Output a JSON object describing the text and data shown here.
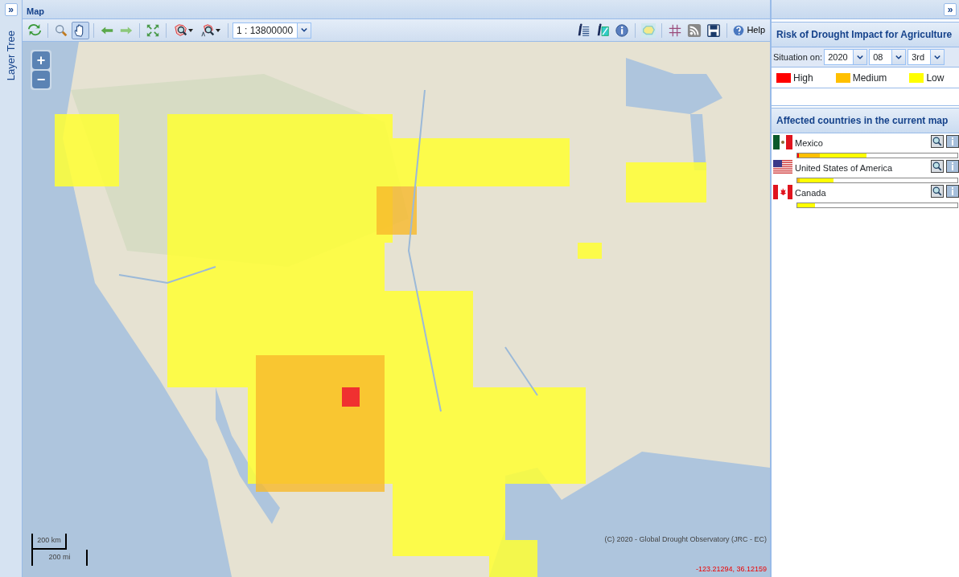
{
  "left_panel": {
    "expand_button": "»",
    "title": "Layer Tree"
  },
  "map_panel": {
    "title": "Map",
    "toolbar_left": [
      {
        "kind": "refresh",
        "selected": false
      },
      {
        "kind": "zoom",
        "selected": false
      },
      {
        "kind": "pan",
        "selected": true
      },
      {
        "kind": "back",
        "selected": false
      },
      {
        "kind": "forward",
        "selected": false
      },
      {
        "kind": "extent",
        "selected": false
      },
      {
        "kind": "region-zoom",
        "selected": false
      },
      {
        "kind": "label-zoom",
        "selected": false
      }
    ],
    "scale_select": {
      "value": "1 : 13800000"
    },
    "toolbar_right": [
      {
        "kind": "info-list"
      },
      {
        "kind": "info-edit"
      },
      {
        "kind": "info"
      },
      {
        "kind": "polygon"
      },
      {
        "kind": "grid"
      },
      {
        "kind": "rss"
      },
      {
        "kind": "save"
      }
    ],
    "help_button": "Help",
    "zoom_controls": [
      "+",
      "−"
    ],
    "scale_bar": {
      "metric": "200 km",
      "imperial": "200 mi"
    },
    "attribution": "(C) 2020 - Global Drought Observatory (JRC - EC)",
    "coordinates": "-123.21294, 36.12159"
  },
  "right_panel": {
    "expand_button": "»",
    "title": "Risk of Drought Impact for Agriculture",
    "situation": {
      "label": "Situation on:",
      "selects": [
        "2020",
        "08",
        "3rd"
      ]
    },
    "legend": [
      {
        "label": "High",
        "color": "#ff0000"
      },
      {
        "label": "Medium",
        "color": "#ffc000"
      },
      {
        "label": "Low",
        "color": "#ffff00"
      }
    ],
    "affected_title": "Affected countries in the current map",
    "countries": [
      {
        "name": "Mexico",
        "kind": "mexico",
        "segments": [
          {
            "color": "#ff0000",
            "level": 0.01
          },
          {
            "color": "#ffc000",
            "level": 0.13
          },
          {
            "color": "#ffff00",
            "level": 0.29
          }
        ]
      },
      {
        "name": "United States of America",
        "kind": "usa",
        "segments": [
          {
            "color": "#ffc000",
            "level": 0.015
          },
          {
            "color": "#ffff00",
            "level": 0.21
          }
        ]
      },
      {
        "name": "Canada",
        "kind": "canada",
        "segments": [
          {
            "color": "#ffff00",
            "level": 0.11
          }
        ]
      }
    ]
  }
}
